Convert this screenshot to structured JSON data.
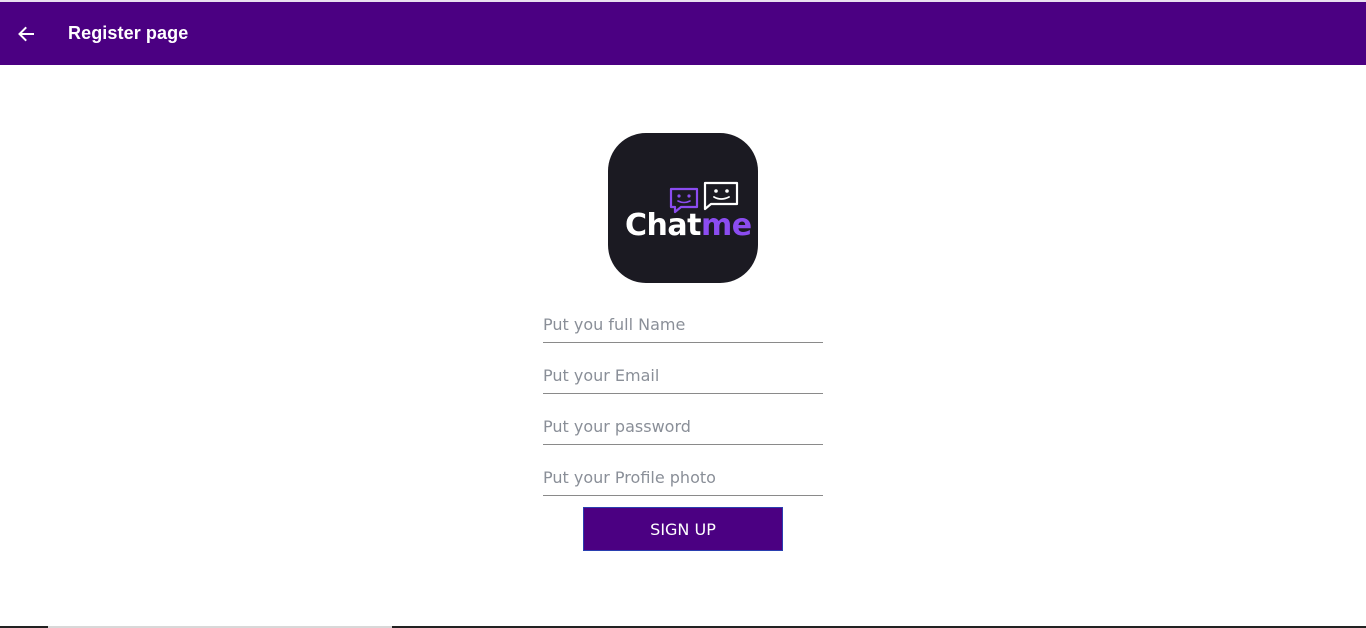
{
  "appbar": {
    "title": "Register page",
    "back_icon": "arrow-left-icon",
    "color": "#4b0082"
  },
  "logo": {
    "text_primary": "Chat",
    "text_accent": "me",
    "background": "#1b1a22",
    "accent_color": "#8b4cf0"
  },
  "form": {
    "full_name_placeholder": "Put you full Name",
    "email_placeholder": "Put your Email",
    "password_placeholder": "Put your password",
    "profile_photo_placeholder": "Put your Profile photo",
    "submit_label": "SIGN UP"
  }
}
